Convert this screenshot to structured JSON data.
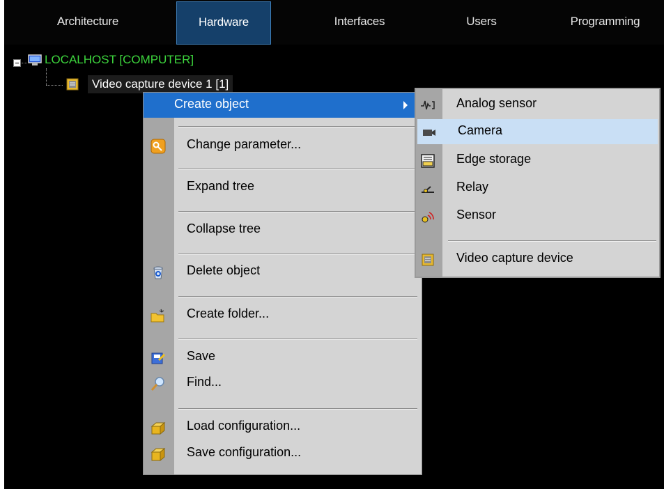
{
  "tabs": [
    {
      "label": "Architecture",
      "active": false
    },
    {
      "label": "Hardware",
      "active": true
    },
    {
      "label": "Interfaces",
      "active": false
    },
    {
      "label": "Users",
      "active": false
    },
    {
      "label": "Programming",
      "active": false
    }
  ],
  "tree": {
    "root_label": "LOCALHOST [COMPUTER]",
    "root_icon": "computer-icon",
    "child_label": "Video capture device 1 [1]",
    "child_icon": "video-capture-device-icon"
  },
  "context_menu": {
    "items": [
      {
        "label": "Create object",
        "icon": "",
        "submenu": true,
        "highlighted": true
      },
      {
        "label": "Change parameter...",
        "icon": "key-icon"
      },
      {
        "label": "Expand tree",
        "icon": ""
      },
      {
        "label": "Collapse tree",
        "icon": ""
      },
      {
        "label": "Delete object",
        "icon": "recycle-bin-icon"
      },
      {
        "label": "Create folder...",
        "icon": "new-folder-icon"
      },
      {
        "label": "Save",
        "icon": "save-icon"
      },
      {
        "label": "Find...",
        "icon": "magnifier-icon"
      },
      {
        "label": "Load configuration...",
        "icon": "box-open-icon"
      },
      {
        "label": "Save configuration...",
        "icon": "box-closed-icon"
      }
    ]
  },
  "submenu": {
    "items": [
      {
        "label": "Analog sensor",
        "icon": "analog-sensor-icon"
      },
      {
        "label": "Camera",
        "icon": "camera-icon",
        "hovered": true
      },
      {
        "label": "Edge storage",
        "icon": "edge-storage-icon"
      },
      {
        "label": "Relay",
        "icon": "relay-icon"
      },
      {
        "label": "Sensor",
        "icon": "sensor-icon"
      },
      {
        "label": "Video capture device",
        "icon": "video-capture-device-icon"
      }
    ]
  },
  "colors": {
    "background": "#000000",
    "active_tab": "#15406a",
    "root_text": "#3dd63d",
    "menu_bg": "#d4d4d4",
    "menu_highlight": "#1f6fcc",
    "submenu_hover": "#c9dff5"
  }
}
